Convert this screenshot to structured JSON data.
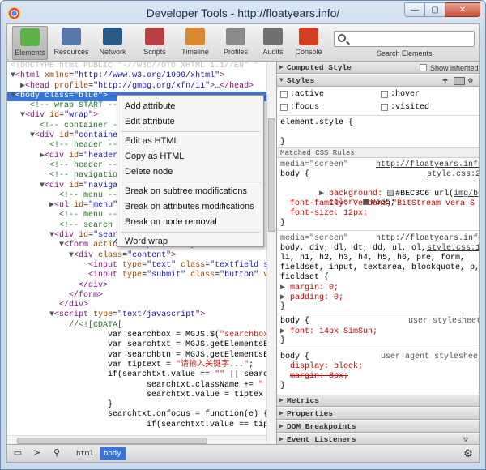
{
  "window": {
    "title": "Developer Tools - http://floatyears.info/",
    "controls": [
      "—",
      "▢",
      "✕"
    ]
  },
  "toolbar": {
    "tools": [
      {
        "label": "Elements",
        "icon": "elements-icon",
        "color": "#5db34a"
      },
      {
        "label": "Resources",
        "icon": "resources-icon",
        "color": "#5577aa"
      },
      {
        "label": "Network",
        "icon": "network-icon",
        "color": "#2a5a8a"
      },
      {
        "label": "Scripts",
        "icon": "scripts-icon",
        "color": "#b84040"
      },
      {
        "label": "Timeline",
        "icon": "timeline-icon",
        "color": "#d98a30"
      },
      {
        "label": "Profiles",
        "icon": "profiles-icon",
        "color": "#8a8a8a"
      },
      {
        "label": "Audits",
        "icon": "audits-icon",
        "color": "#707070"
      },
      {
        "label": "Console",
        "icon": "console-icon",
        "color": "#d04020"
      }
    ],
    "search_placeholder": "",
    "search_caption": "Search Elements"
  },
  "dom_lines": [
    {
      "h": "<span class='dt'>&lt;!DOCTYPE html PUBLIC \"-//W3C//DTD XHTML 1.1//EN\" \"</span>"
    },
    {
      "h": "<span class='arr'>▼</span><span class='tg'>&lt;html</span> <span class='an'>xmlns</span>=<span class='av'>\"http://www.w3.org/1999/xhtml\"</span><span class='tg'>&gt;</span>"
    },
    {
      "h": "  <span class='arr'>▶</span><span class='tg'>&lt;head</span> <span class='an'>profile</span>=<span class='av'>\"http://gmpg.org/xfn/11\"</span><span class='tg'>&gt;</span>…<span class='tg'>&lt;/head&gt;</span>"
    },
    {
      "h": "<span class='arr'>▼</span>&lt;body class=\"blue\"&gt;",
      "sel": true
    },
    {
      "h": "    <span class='cm'>&lt;!-- wrap START --&gt;</span>"
    },
    {
      "h": "  <span class='arr'>▼</span><span class='tg'>&lt;div</span> <span class='an'>id</span>=<span class='av'>\"wrap\"</span><span class='tg'>&gt;</span>"
    },
    {
      "h": "      <span class='cm'>&lt;!-- container --&gt;</span>"
    },
    {
      "h": "    <span class='arr'>▼</span><span class='tg'>&lt;div</span> <span class='an'>id</span>=<span class='av'>\"container\"</span><span class='tg'>&gt;</span>"
    },
    {
      "h": "        <span class='cm'>&lt;!-- header --&gt;</span>"
    },
    {
      "h": "      <span class='arr'>▶</span><span class='tg'>&lt;div</span> <span class='an'>id</span>=<span class='av'>\"header\"</span><span class='tg'>&gt;</span>"
    },
    {
      "h": "        <span class='cm'>&lt;!-- header --&gt;</span>"
    },
    {
      "h": "        <span class='cm'>&lt;!-- navigation --&gt;</span>"
    },
    {
      "h": "      <span class='arr'>▼</span><span class='tg'>&lt;div</span> <span class='an'>id</span>=<span class='av'>\"navigation\"</span><span class='tg'>&gt;</span>"
    },
    {
      "h": "          <span class='cm'>&lt;!-- menu --&gt;</span>"
    },
    {
      "h": "        <span class='arr'>▶</span><span class='tg'>&lt;ul</span> <span class='an'>id</span>=<span class='av'>\"menu\"</span><span class='tg'>&gt;</span>"
    },
    {
      "h": "          <span class='cm'>&lt;!-- menu --&gt;</span>"
    },
    {
      "h": "          <span class='cm'>&lt;!-- search --&gt;</span>"
    },
    {
      "h": "        <span class='arr'>▼</span><span class='tg'>&lt;div</span> <span class='an'>id</span>=<span class='av'>\"search\"</span><span class='tg'>&gt;</span>"
    },
    {
      "h": "          <span class='arr'>▼</span><span class='tg'>&lt;form</span> <span class='an'>action</span>=<span class='av'>\"http://floatyears.info\"</span> <span class='an'>met</span>"
    },
    {
      "h": "            <span class='arr'>▼</span><span class='tg'>&lt;div</span> <span class='an'>class</span>=<span class='av'>\"content\"</span><span class='tg'>&gt;</span>"
    },
    {
      "h": "                <span class='tg'>&lt;input</span> <span class='an'>type</span>=<span class='av'>\"text\"</span> <span class='an'>class</span>=<span class='av'>\"textfield s</span>"
    },
    {
      "h": "                <span class='tg'>&lt;input</span> <span class='an'>type</span>=<span class='av'>\"submit\"</span> <span class='an'>class</span>=<span class='av'>\"button\"</span> <span class='an'>v</span>"
    },
    {
      "h": "              <span class='tg'>&lt;/div&gt;</span>"
    },
    {
      "h": "            <span class='tg'>&lt;/form&gt;</span>"
    },
    {
      "h": "          <span class='tg'>&lt;/div&gt;</span>"
    },
    {
      "h": "        <span class='arr'>▼</span><span class='tg'>&lt;script</span> <span class='an'>type</span>=<span class='av'>\"text/javascript\"</span><span class='tg'>&gt;</span>"
    },
    {
      "h": "            <span class='cm'>//&lt;![CDATA[</span>"
    },
    {
      "h": "                    <span class='js'>var searchbox = MGJS.$(</span><span class='str'>\"searchbox</span>"
    },
    {
      "h": "                    <span class='js'>var searchtxt = MGJS.getElementsB</span>"
    },
    {
      "h": "                    <span class='js'>var searchbtn = MGJS.getElementsB</span>"
    },
    {
      "h": "                    <span class='js'>var tiptext = </span><span class='str'>\"请输入关键字...\"</span><span class='js'>;</span>"
    },
    {
      "h": "                    <span class='js'>if(searchtxt.value == </span><span class='str'>\"\"</span><span class='js'> || searc</span>"
    },
    {
      "h": "                            <span class='js'>searchtxt.className += </span><span class='str'>\"</span>"
    },
    {
      "h": "                            <span class='js'>searchtxt.value = tiptex</span>"
    },
    {
      "h": "                    <span class='js'>}</span>"
    },
    {
      "h": "                    <span class='js'>searchtxt.onfocus = function(e) {</span>"
    },
    {
      "h": "                            <span class='js'>if(searchtxt.value == tip</span>"
    }
  ],
  "context_menu": {
    "groups": [
      [
        "Add attribute",
        "Edit attribute"
      ],
      [
        "Edit as HTML",
        "Copy as HTML",
        "Delete node"
      ],
      [
        "Break on subtree modifications",
        "Break on attributes modifications",
        "Break on node removal"
      ],
      [
        "Word wrap"
      ]
    ],
    "checked": "Word wrap"
  },
  "sidebar": {
    "computed_style": "Computed Style",
    "show_inherited": "Show inherited",
    "styles": "Styles",
    "pseudo": [
      ":active",
      ":hover",
      ":focus",
      ":visited"
    ],
    "element_style": "element.style {",
    "element_close": "}",
    "matched": "Matched CSS Rules",
    "rule1": {
      "media": "media=\"screen\"",
      "link": "http://floatyears.info/",
      "selector": "body {",
      "file": "style.css:20",
      "bg_prop": "background:",
      "bg_val": "#BEC3C6 url(",
      "bg_url": "img/bg.jpg",
      "bg_rest": ") ",
      "bg_swatch": "#BEC3C6",
      "color_prop": "color:",
      "color_val": "#555;",
      "color_swatch": "#555555",
      "ff": "font-family: Verdana,\"BitStream vera S",
      "fs": "font-size: 12px;",
      "close": "}"
    },
    "rule2": {
      "media": "media=\"screen\"",
      "link": "http://floatyears.info/",
      "sel1": "body, div, dl, dt, dd, ul, ol,",
      "file": "style.css:12",
      "sel2": "li, h1, h2, h3, h4, h5, h6, pre, form,",
      "sel3": "fieldset, input, textarea, blockquote, p,",
      "sel4": "fieldset {",
      "margin": "margin: 0;",
      "padding": "padding: 0;",
      "close": "}"
    },
    "rule3": {
      "selector": "body {",
      "origin": "user stylesheet",
      "font": "font: 14px SimSun;",
      "close": "}"
    },
    "rule4": {
      "selector": "body {",
      "origin": "user agent stylesheet",
      "display": "display: block;",
      "margin": "margin: 8px;",
      "close": "}"
    },
    "sections": [
      "Metrics",
      "Properties",
      "DOM Breakpoints",
      "Event Listeners"
    ]
  },
  "statusbar": {
    "crumbs": [
      "html",
      "body"
    ]
  }
}
